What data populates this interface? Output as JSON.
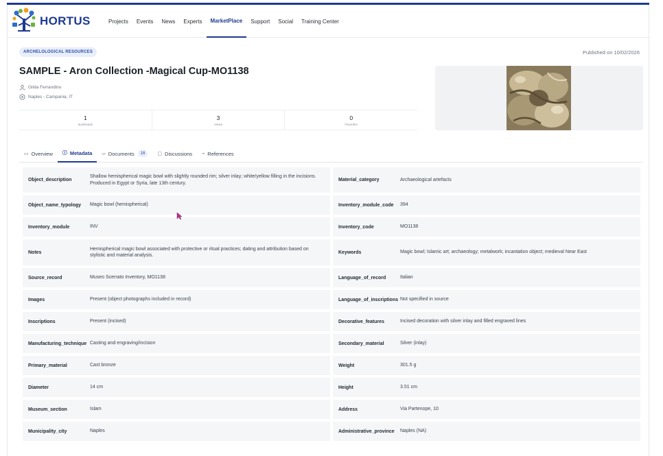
{
  "nav": {
    "brand": "HORTUS",
    "items": [
      "Projects",
      "Events",
      "News",
      "Experts",
      "MarketPlace",
      "Support",
      "Social",
      "Training Center"
    ],
    "active": "MarketPlace"
  },
  "header": {
    "category": "ARCHELOLOGICAL RESOURCES",
    "published": "Published on  10/02/2026",
    "title": "SAMPLE - Aron Collection -Magical Cup-MO1138",
    "author": "Gilda Ferrandino",
    "location": "Naples - Campania, IT"
  },
  "stats": [
    {
      "value": "1",
      "label": "downloads"
    },
    {
      "value": "3",
      "label": "Views"
    },
    {
      "value": "0",
      "label": "Favorites"
    }
  ],
  "tabs": [
    {
      "label": "Overview",
      "icon": "doc-icon"
    },
    {
      "label": "Metadata",
      "icon": "info-icon",
      "active": true
    },
    {
      "label": "Documents",
      "icon": "folder-icon",
      "count": "16"
    },
    {
      "label": "Discussions",
      "icon": "chat-icon"
    },
    {
      "label": "References",
      "icon": "link-icon"
    }
  ],
  "metadata_rows": [
    [
      {
        "key": "Object_description",
        "value": "Shallow hemispherical magic bowl with slightly rounded rim; silver inlay; white/yellow filling in the incisions. Produced in Egypt or Syria, late 13th century."
      },
      {
        "key": "Material_category",
        "value": "Archaeological artefacts"
      }
    ],
    [
      {
        "key": "Object_name_typology",
        "value": "Magic bowl (hemispherical)"
      },
      {
        "key": "Inventory_module_code",
        "value": "394"
      }
    ],
    [
      {
        "key": "Inventory_module",
        "value": "INV"
      },
      {
        "key": "Inventory_code",
        "value": "MO1138"
      }
    ],
    [
      {
        "key": "Notes",
        "value": "Hemispherical magic bowl associated with protective or ritual practices; dating and attribution based on stylistic and material analysis."
      },
      {
        "key": "Keywords",
        "value": "Magic bowl; Islamic art; archaeology; metalwork; incantation object; medieval Near East"
      }
    ],
    [
      {
        "key": "Source_record",
        "value": "Museo Scerrato Inventory, MO1138"
      },
      {
        "key": "Language_of_record",
        "value": "Italian"
      }
    ],
    [
      {
        "key": "Images",
        "value": "Present (object photographs included in record)"
      },
      {
        "key": "Language_of_inscriptions",
        "value": "Not specified in source"
      }
    ],
    [
      {
        "key": "Inscriptions",
        "value": "Present (incised)"
      },
      {
        "key": "Decorative_features",
        "value": "Incised decoration with silver inlay and filled engraved lines"
      }
    ],
    [
      {
        "key": "Manufacturing_technique",
        "value": "Casting and engraving/incision"
      },
      {
        "key": "Secondary_material",
        "value": "Silver (inlay)"
      }
    ],
    [
      {
        "key": "Primary_material",
        "value": "Cast bronze"
      },
      {
        "key": "Weight",
        "value": "301.5 g"
      }
    ],
    [
      {
        "key": "Diameter",
        "value": "14 cm"
      },
      {
        "key": "Height",
        "value": "3.51 cm"
      }
    ],
    [
      {
        "key": "Museum_section",
        "value": "Islam"
      },
      {
        "key": "Address",
        "value": "Via Partenope, 10"
      }
    ],
    [
      {
        "key": "Municipality_city",
        "value": "Naples"
      },
      {
        "key": "Administrative_province",
        "value": "Naples (NA)"
      }
    ]
  ],
  "colors": {
    "accent": "#1d3a8f",
    "badge_bg": "#e8eefb",
    "row_bg": "#f5f6f8"
  }
}
